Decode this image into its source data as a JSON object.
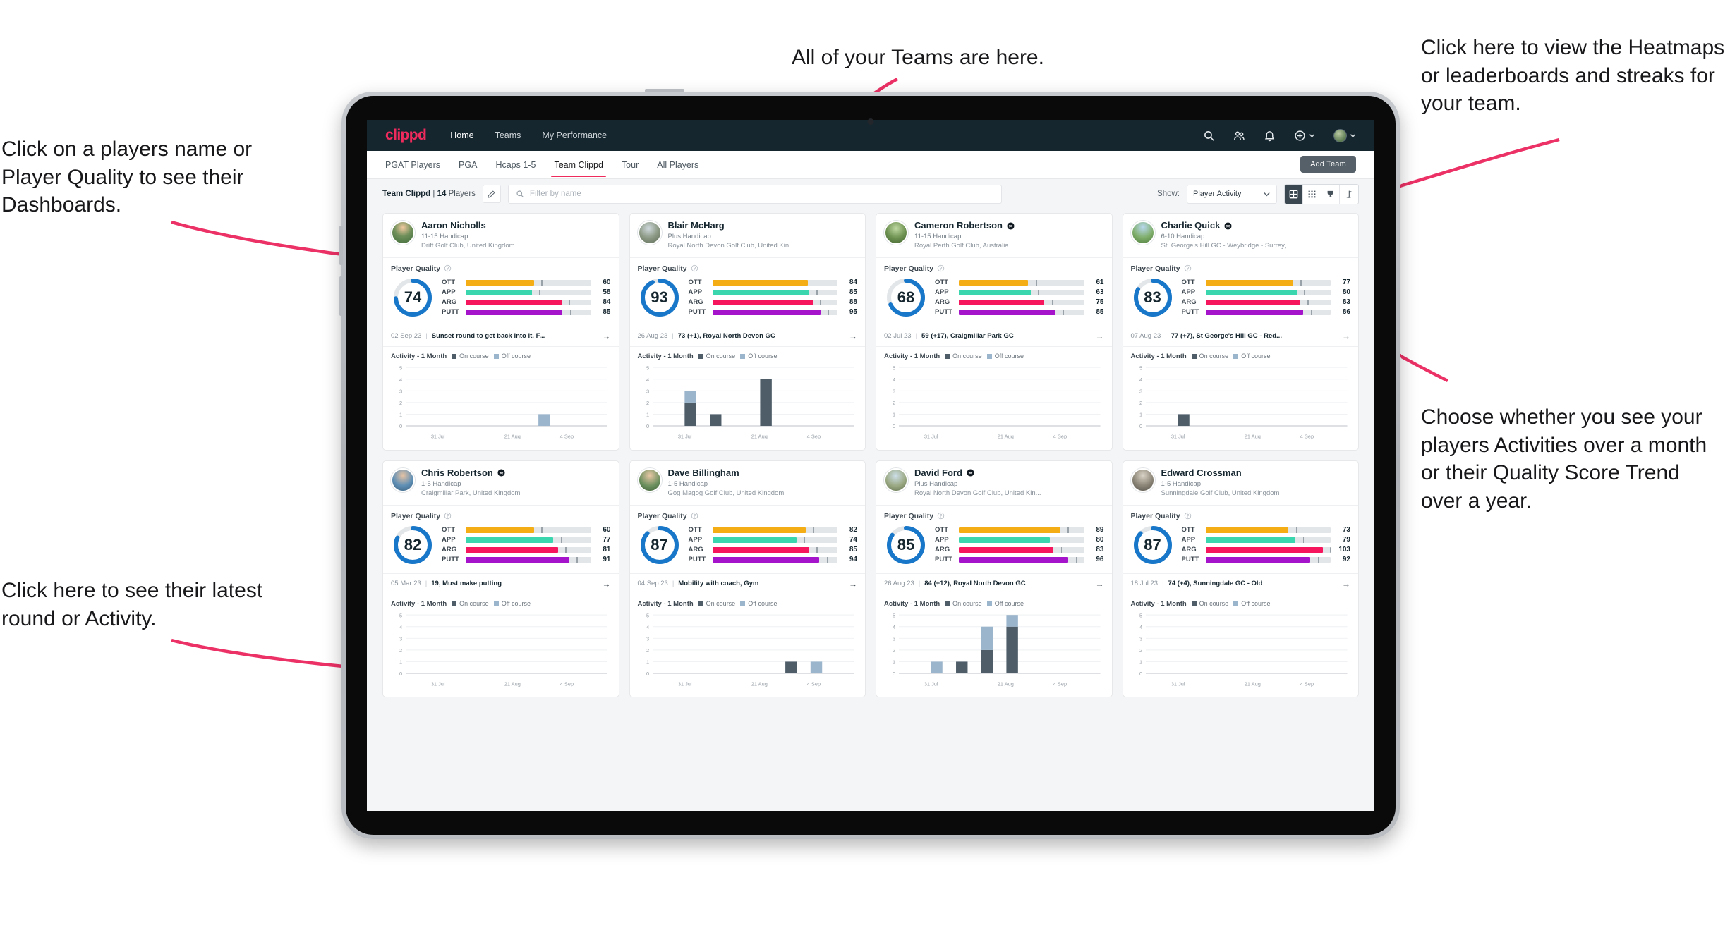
{
  "annotations": [
    {
      "id": "players-name",
      "text": "Click on a players name or Player Quality to see their Dashboards."
    },
    {
      "id": "teams-here",
      "text": "All of your Teams are here."
    },
    {
      "id": "heatmaps",
      "text": "Click here to view the Heatmaps or leaderboards and streaks for your team."
    },
    {
      "id": "activity-toggle",
      "text": "Choose whether you see your players Activities over a month or their Quality Score Trend over a year."
    },
    {
      "id": "latest-round",
      "text": "Click here to see their latest round or Activity."
    }
  ],
  "app": {
    "logo": "clippd",
    "nav": [
      {
        "label": "Home",
        "active": true
      },
      {
        "label": "Teams",
        "active": false
      },
      {
        "label": "My Performance",
        "active": false
      }
    ],
    "header_icons": [
      "search-icon",
      "people-icon",
      "bell-icon",
      "plus-icon",
      "avatar"
    ],
    "tabs": [
      {
        "label": "PGAT Players",
        "active": false
      },
      {
        "label": "PGA",
        "active": false
      },
      {
        "label": "Hcaps 1-5",
        "active": false
      },
      {
        "label": "Team Clippd",
        "active": true
      },
      {
        "label": "Tour",
        "active": false
      },
      {
        "label": "All Players",
        "active": false
      }
    ],
    "add_team_label": "Add Team",
    "toolbar": {
      "team_name": "Team Clippd",
      "team_sep": "|",
      "player_count": "14",
      "players_word": "Players",
      "edit_icon": "pencil-icon",
      "search_placeholder": "Filter by name",
      "show_label": "Show:",
      "show_value": "Player Activity",
      "views": [
        {
          "name": "grid-view",
          "active": true
        },
        {
          "name": "dense-grid-view",
          "active": false
        },
        {
          "name": "trophy-view",
          "active": false
        },
        {
          "name": "flag-view",
          "active": false
        }
      ]
    }
  },
  "colors": {
    "brand": "#ef2a5d",
    "header_bg": "#16262f",
    "ring": "#1877c9",
    "ott": "#f5ad15",
    "app": "#3ad6ad",
    "arg": "#f5165e",
    "putt": "#a513cb",
    "on_course": "#4e5d68",
    "off_course": "#9bb5cc",
    "annotation_arrow": "#ec3166"
  },
  "cards_common": {
    "player_quality_label": "Player Quality",
    "activity_label": "Activity - 1 Month",
    "legend": [
      {
        "label": "On course",
        "color": "#4e5d68"
      },
      {
        "label": "Off course",
        "color": "#9bb5cc"
      }
    ],
    "metric_labels": [
      "OTT",
      "APP",
      "ARG",
      "PUTT"
    ],
    "y_ticks": [
      "5",
      "4",
      "3",
      "2",
      "1",
      "0"
    ],
    "x_ticks": [
      "31 Jul",
      "21 Aug",
      "4 Sep"
    ]
  },
  "players": [
    {
      "name": "Aaron Nicholls",
      "verified": false,
      "handicap": "11-15 Handicap",
      "club": "Drift Golf Club, United Kingdom",
      "quality": 74,
      "metrics": [
        {
          "label": "OTT",
          "value": 60,
          "color": "#f5ad15"
        },
        {
          "label": "APP",
          "value": 58,
          "color": "#3ad6ad"
        },
        {
          "label": "ARG",
          "value": 84,
          "color": "#f5165e"
        },
        {
          "label": "PUTT",
          "value": 85,
          "color": "#a513cb"
        }
      ],
      "round_date": "02 Sep 23",
      "round_text": "Sunset round to get back into it, F...",
      "chart_data": {
        "type": "bar",
        "stacked": true,
        "title": "Activity - 1 Month",
        "ylim": [
          0,
          5
        ],
        "yticks": [
          0,
          1,
          2,
          3,
          4,
          5
        ],
        "xticks": [
          "31 Jul",
          "21 Aug",
          "4 Sep"
        ],
        "series": [
          {
            "name": "On course",
            "color": "#4e5d68",
            "values": [
              0,
              0,
              0,
              0,
              0,
              0,
              0,
              0
            ]
          },
          {
            "name": "Off course",
            "color": "#9bb5cc",
            "values": [
              0,
              0,
              0,
              0,
              0,
              1,
              0,
              0
            ]
          }
        ]
      }
    },
    {
      "name": "Blair McHarg",
      "verified": false,
      "handicap": "Plus Handicap",
      "club": "Royal North Devon Golf Club, United Kin...",
      "quality": 93,
      "metrics": [
        {
          "label": "OTT",
          "value": 84,
          "color": "#f5ad15"
        },
        {
          "label": "APP",
          "value": 85,
          "color": "#3ad6ad"
        },
        {
          "label": "ARG",
          "value": 88,
          "color": "#f5165e"
        },
        {
          "label": "PUTT",
          "value": 95,
          "color": "#a513cb"
        }
      ],
      "round_date": "26 Aug 23",
      "round_text": "73 (+1), Royal North Devon GC",
      "chart_data": {
        "type": "bar",
        "stacked": true,
        "title": "Activity - 1 Month",
        "ylim": [
          0,
          5
        ],
        "yticks": [
          0,
          1,
          2,
          3,
          4,
          5
        ],
        "xticks": [
          "31 Jul",
          "21 Aug",
          "4 Sep"
        ],
        "series": [
          {
            "name": "On course",
            "color": "#4e5d68",
            "values": [
              0,
              2,
              1,
              0,
              4,
              0,
              0,
              0
            ]
          },
          {
            "name": "Off course",
            "color": "#9bb5cc",
            "values": [
              0,
              1,
              0,
              0,
              0,
              0,
              0,
              0
            ]
          }
        ]
      }
    },
    {
      "name": "Cameron Robertson",
      "verified": true,
      "handicap": "11-15 Handicap",
      "club": "Royal Perth Golf Club, Australia",
      "quality": 68,
      "metrics": [
        {
          "label": "OTT",
          "value": 61,
          "color": "#f5ad15"
        },
        {
          "label": "APP",
          "value": 63,
          "color": "#3ad6ad"
        },
        {
          "label": "ARG",
          "value": 75,
          "color": "#f5165e"
        },
        {
          "label": "PUTT",
          "value": 85,
          "color": "#a513cb"
        }
      ],
      "round_date": "02 Jul 23",
      "round_text": "59 (+17), Craigmillar Park GC",
      "chart_data": {
        "type": "bar",
        "stacked": true,
        "title": "Activity - 1 Month",
        "ylim": [
          0,
          5
        ],
        "yticks": [
          0,
          1,
          2,
          3,
          4,
          5
        ],
        "xticks": [
          "31 Jul",
          "21 Aug",
          "4 Sep"
        ],
        "series": [
          {
            "name": "On course",
            "color": "#4e5d68",
            "values": [
              0,
              0,
              0,
              0,
              0,
              0,
              0,
              0
            ]
          },
          {
            "name": "Off course",
            "color": "#9bb5cc",
            "values": [
              0,
              0,
              0,
              0,
              0,
              0,
              0,
              0
            ]
          }
        ]
      }
    },
    {
      "name": "Charlie Quick",
      "verified": true,
      "handicap": "6-10 Handicap",
      "club": "St. George's Hill GC - Weybridge - Surrey, ...",
      "quality": 83,
      "metrics": [
        {
          "label": "OTT",
          "value": 77,
          "color": "#f5ad15"
        },
        {
          "label": "APP",
          "value": 80,
          "color": "#3ad6ad"
        },
        {
          "label": "ARG",
          "value": 83,
          "color": "#f5165e"
        },
        {
          "label": "PUTT",
          "value": 86,
          "color": "#a513cb"
        }
      ],
      "round_date": "07 Aug 23",
      "round_text": "77 (+7), St George's Hill GC - Red...",
      "chart_data": {
        "type": "bar",
        "stacked": true,
        "title": "Activity - 1 Month",
        "ylim": [
          0,
          5
        ],
        "yticks": [
          0,
          1,
          2,
          3,
          4,
          5
        ],
        "xticks": [
          "31 Jul",
          "21 Aug",
          "4 Sep"
        ],
        "series": [
          {
            "name": "On course",
            "color": "#4e5d68",
            "values": [
              0,
              1,
              0,
              0,
              0,
              0,
              0,
              0
            ]
          },
          {
            "name": "Off course",
            "color": "#9bb5cc",
            "values": [
              0,
              0,
              0,
              0,
              0,
              0,
              0,
              0
            ]
          }
        ]
      }
    },
    {
      "name": "Chris Robertson",
      "verified": true,
      "handicap": "1-5 Handicap",
      "club": "Craigmillar Park, United Kingdom",
      "quality": 82,
      "metrics": [
        {
          "label": "OTT",
          "value": 60,
          "color": "#f5ad15"
        },
        {
          "label": "APP",
          "value": 77,
          "color": "#3ad6ad"
        },
        {
          "label": "ARG",
          "value": 81,
          "color": "#f5165e"
        },
        {
          "label": "PUTT",
          "value": 91,
          "color": "#a513cb"
        }
      ],
      "round_date": "05 Mar 23",
      "round_text": "19, Must make putting",
      "chart_data": {
        "type": "bar",
        "stacked": true,
        "title": "Activity - 1 Month",
        "ylim": [
          0,
          5
        ],
        "yticks": [
          0,
          1,
          2,
          3,
          4,
          5
        ],
        "xticks": [
          "31 Jul",
          "21 Aug",
          "4 Sep"
        ],
        "series": [
          {
            "name": "On course",
            "color": "#4e5d68",
            "values": [
              0,
              0,
              0,
              0,
              0,
              0,
              0,
              0
            ]
          },
          {
            "name": "Off course",
            "color": "#9bb5cc",
            "values": [
              0,
              0,
              0,
              0,
              0,
              0,
              0,
              0
            ]
          }
        ]
      }
    },
    {
      "name": "Dave Billingham",
      "verified": false,
      "handicap": "1-5 Handicap",
      "club": "Gog Magog Golf Club, United Kingdom",
      "quality": 87,
      "metrics": [
        {
          "label": "OTT",
          "value": 82,
          "color": "#f5ad15"
        },
        {
          "label": "APP",
          "value": 74,
          "color": "#3ad6ad"
        },
        {
          "label": "ARG",
          "value": 85,
          "color": "#f5165e"
        },
        {
          "label": "PUTT",
          "value": 94,
          "color": "#a513cb"
        }
      ],
      "round_date": "04 Sep 23",
      "round_text": "Mobility with coach, Gym",
      "chart_data": {
        "type": "bar",
        "stacked": true,
        "title": "Activity - 1 Month",
        "ylim": [
          0,
          5
        ],
        "yticks": [
          0,
          1,
          2,
          3,
          4,
          5
        ],
        "xticks": [
          "31 Jul",
          "21 Aug",
          "4 Sep"
        ],
        "series": [
          {
            "name": "On course",
            "color": "#4e5d68",
            "values": [
              0,
              0,
              0,
              0,
              0,
              1,
              0,
              0
            ]
          },
          {
            "name": "Off course",
            "color": "#9bb5cc",
            "values": [
              0,
              0,
              0,
              0,
              0,
              0,
              1,
              0
            ]
          }
        ]
      }
    },
    {
      "name": "David Ford",
      "verified": true,
      "handicap": "Plus Handicap",
      "club": "Royal North Devon Golf Club, United Kin...",
      "quality": 85,
      "metrics": [
        {
          "label": "OTT",
          "value": 89,
          "color": "#f5ad15"
        },
        {
          "label": "APP",
          "value": 80,
          "color": "#3ad6ad"
        },
        {
          "label": "ARG",
          "value": 83,
          "color": "#f5165e"
        },
        {
          "label": "PUTT",
          "value": 96,
          "color": "#a513cb"
        }
      ],
      "round_date": "26 Aug 23",
      "round_text": "84 (+12), Royal North Devon GC",
      "chart_data": {
        "type": "bar",
        "stacked": true,
        "title": "Activity - 1 Month",
        "ylim": [
          0,
          5
        ],
        "yticks": [
          0,
          1,
          2,
          3,
          4,
          5
        ],
        "xticks": [
          "31 Jul",
          "21 Aug",
          "4 Sep"
        ],
        "series": [
          {
            "name": "On course",
            "color": "#4e5d68",
            "values": [
              0,
              0,
              1,
              2,
              4,
              0,
              0,
              0
            ]
          },
          {
            "name": "Off course",
            "color": "#9bb5cc",
            "values": [
              0,
              1,
              0,
              2,
              1,
              0,
              0,
              0
            ]
          }
        ]
      }
    },
    {
      "name": "Edward Crossman",
      "verified": false,
      "handicap": "1-5 Handicap",
      "club": "Sunningdale Golf Club, United Kingdom",
      "quality": 87,
      "metrics": [
        {
          "label": "OTT",
          "value": 73,
          "color": "#f5ad15"
        },
        {
          "label": "APP",
          "value": 79,
          "color": "#3ad6ad"
        },
        {
          "label": "ARG",
          "value": 103,
          "color": "#f5165e"
        },
        {
          "label": "PUTT",
          "value": 92,
          "color": "#a513cb"
        }
      ],
      "round_date": "18 Jul 23",
      "round_text": "74 (+4), Sunningdale GC - Old",
      "chart_data": {
        "type": "bar",
        "stacked": true,
        "title": "Activity - 1 Month",
        "ylim": [
          0,
          5
        ],
        "yticks": [
          0,
          1,
          2,
          3,
          4,
          5
        ],
        "xticks": [
          "31 Jul",
          "21 Aug",
          "4 Sep"
        ],
        "series": [
          {
            "name": "On course",
            "color": "#4e5d68",
            "values": [
              0,
              0,
              0,
              0,
              0,
              0,
              0,
              0
            ]
          },
          {
            "name": "Off course",
            "color": "#9bb5cc",
            "values": [
              0,
              0,
              0,
              0,
              0,
              0,
              0,
              0
            ]
          }
        ]
      }
    }
  ]
}
